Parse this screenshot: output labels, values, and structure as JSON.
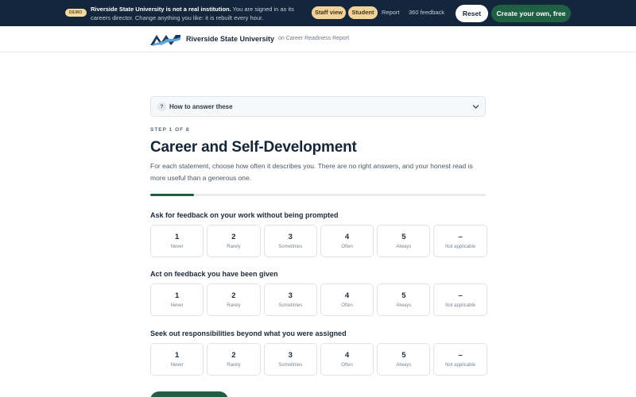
{
  "banner": {
    "badge": "DEMO",
    "headline": "Riverside State University is not a real institution.",
    "message": "You are signed in as its careers director. Change anything you like: it is rebuilt every hour.",
    "view_staff": "Staff view",
    "view_student": "Student",
    "link_report": "Report",
    "link_360": "360 feedback",
    "reset_label": "Reset",
    "create_label": "Create your own, free"
  },
  "header": {
    "institution": "Riverside State University",
    "report": "on Career Readiness Report"
  },
  "help": {
    "icon": "question-icon",
    "glyph": "?",
    "label": "How to answer these"
  },
  "step": {
    "label": "STEP 1 OF 8",
    "title": "Career and Self-Development",
    "description": "For each statement, choose how often it describes you. There are no right answers, and your honest read is more useful than a generous one.",
    "progress": 0.13
  },
  "scale": [
    {
      "value": "1",
      "label": "Never"
    },
    {
      "value": "2",
      "label": "Rarely"
    },
    {
      "value": "3",
      "label": "Sometimes"
    },
    {
      "value": "4",
      "label": "Often"
    },
    {
      "value": "5",
      "label": "Always"
    },
    {
      "value": "–",
      "label": "Not applicable"
    }
  ],
  "questions": [
    {
      "text": "Ask for feedback on your work without being prompted"
    },
    {
      "text": "Act on feedback you have been given"
    },
    {
      "text": "Seek out responsibilities beyond what you were assigned"
    }
  ],
  "colors": {
    "brand_dark": "#13263c",
    "accent_green": "#1f5f43",
    "pill_gold": "#f0d29c"
  }
}
